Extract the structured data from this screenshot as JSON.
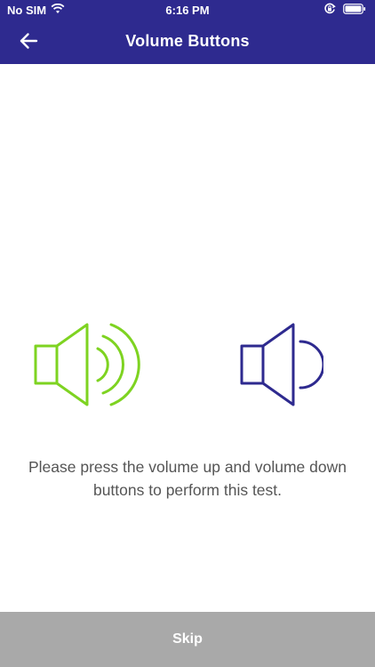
{
  "status_bar": {
    "carrier": "No SIM",
    "time": "6:16 PM",
    "icons": [
      "wifi-icon",
      "orientation-lock-icon",
      "battery-icon"
    ]
  },
  "header": {
    "back_icon": "arrow-left-icon",
    "title": "Volume Buttons"
  },
  "main": {
    "volume_up_icon": "speaker-volume-up-icon",
    "volume_down_icon": "speaker-volume-down-icon",
    "instruction": "Please press the volume up and volume down buttons to perform this test."
  },
  "footer": {
    "skip_label": "Skip"
  },
  "colors": {
    "header_bg": "#2e2a8f",
    "volume_up": "#7ed321",
    "volume_down": "#2e2a8f",
    "skip_bg": "#a9a9a9",
    "text": "#555555"
  }
}
